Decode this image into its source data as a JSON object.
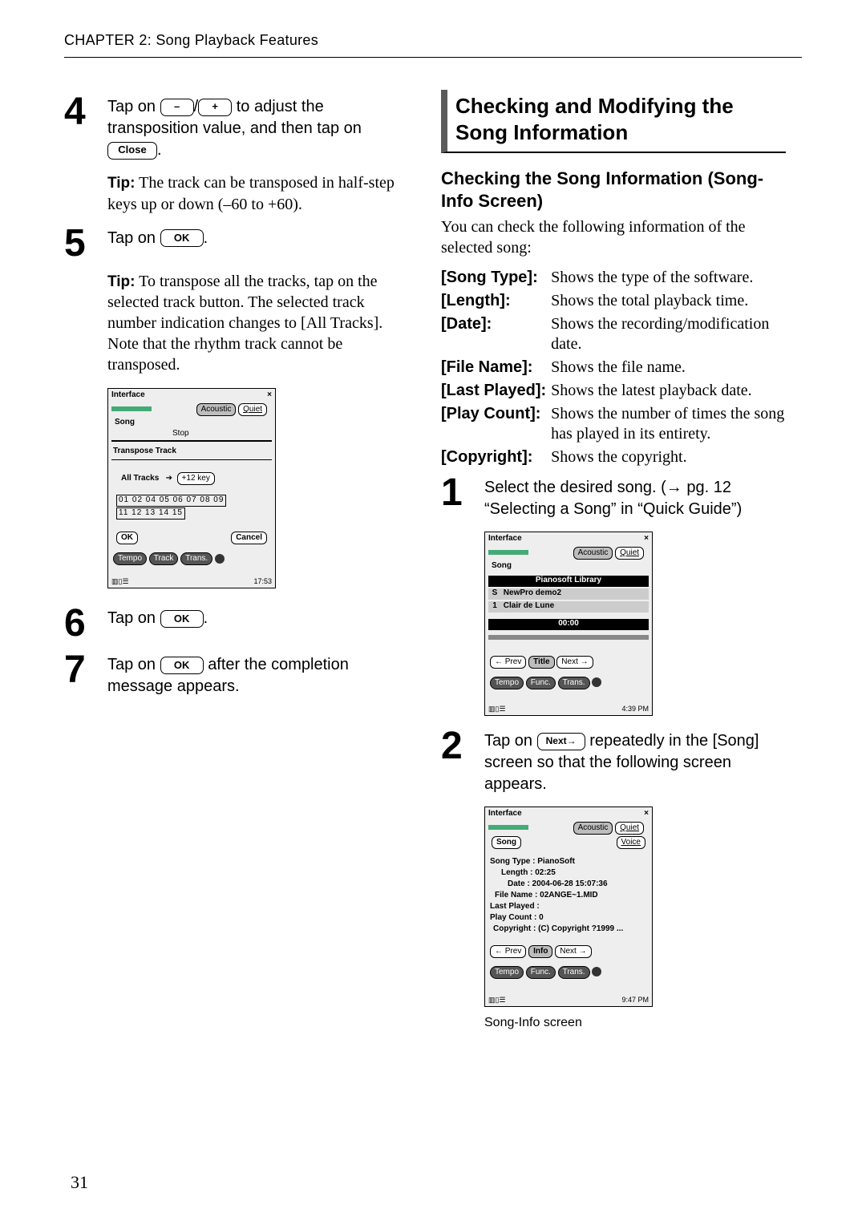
{
  "header": {
    "chapter": "CHAPTER 2: Song Playback Features"
  },
  "buttons": {
    "minus": "–",
    "plus": "+",
    "close": "Close",
    "ok": "OK",
    "next": "Next"
  },
  "left": {
    "step4": {
      "num": "4",
      "text_a": "Tap on",
      "text_b": "/",
      "text_c": "to adjust the transposition value, and then tap on",
      "text_d": "."
    },
    "tip4": {
      "label": "Tip:",
      "text": "The track can be transposed in half-step keys up or down (–60 to +60)."
    },
    "step5": {
      "num": "5",
      "text_a": "Tap on",
      "text_b": "."
    },
    "tip5": {
      "label": "Tip:",
      "text": "To transpose all the tracks, tap on the selected track button. The selected track number indication changes to [All Tracks]. Note that the rhythm track cannot be transposed."
    },
    "screenshot1": {
      "title": "Interface",
      "tab_acoustic": "Acoustic",
      "tab_quiet": "Quiet",
      "song": "Song",
      "stop": "Stop",
      "section": "Transpose Track",
      "all_tracks": "All Tracks",
      "keyval": "+12 key",
      "tracks_row1": "01 02    04 05 06 07 08 09",
      "tracks_row2": "11 12 13 14 15",
      "ok": "OK",
      "cancel": "Cancel",
      "tempo": "Tempo",
      "track": "Track",
      "trans": "Trans.",
      "time": "17:53"
    },
    "step6": {
      "num": "6",
      "text_a": "Tap on",
      "text_b": "."
    },
    "step7": {
      "num": "7",
      "text_a": "Tap on",
      "text_b": "after the completion message appears."
    }
  },
  "right": {
    "section_title": "Checking and Modifying the Song Information",
    "subheading": "Checking the Song Information (Song-Info Screen)",
    "intro": "You can check the following information of the selected song:",
    "info": [
      {
        "k": "[Song Type]:",
        "v": "Shows the type of the software."
      },
      {
        "k": "[Length]:",
        "v": "Shows the total playback time."
      },
      {
        "k": "[Date]:",
        "v": "Shows the recording/modification date."
      },
      {
        "k": "[File Name]:",
        "v": "Shows the file name."
      },
      {
        "k": "[Last Played]:",
        "v": "Shows the latest playback date."
      },
      {
        "k": "[Play Count]:",
        "v": "Shows the number of times the song has played in its entirety."
      },
      {
        "k": "[Copyright]:",
        "v": "Shows the copyright."
      }
    ],
    "step1": {
      "num": "1",
      "text": "Select the desired song. (→ pg. 12 “Selecting a Song” in “Quick Guide”)"
    },
    "screenshot2": {
      "title": "Interface",
      "tab_acoustic": "Acoustic",
      "tab_quiet": "Quiet",
      "song": "Song",
      "lib": "Pianosoft Library",
      "row_s": "S",
      "row_s_name": "NewPro demo2",
      "row_1": "1",
      "row_1_name": "Clair de Lune",
      "time_disp": "00:00",
      "prev": "Prev",
      "title_tab": "Title",
      "next": "Next",
      "tempo": "Tempo",
      "func": "Func.",
      "trans": "Trans.",
      "clock": "4:39 PM"
    },
    "step2": {
      "num": "2",
      "text_a": "Tap on",
      "text_b": "repeatedly in the [Song] screen so that the following screen appears."
    },
    "screenshot3": {
      "title": "Interface",
      "tab_acoustic": "Acoustic",
      "tab_quiet": "Quiet",
      "song": "Song",
      "voice": "Voice",
      "l1": "Song Type : PianoSoft",
      "l2": "Length : 02:25",
      "l3": "Date : 2004-06-28 15:07:36",
      "l4": "File Name : 02ANGE~1.MID",
      "l5": "Last Played :",
      "l6": "Play Count : 0",
      "l7": "Copyright : (C) Copyright ?1999 ...",
      "prev": "Prev",
      "info": "Info",
      "next": "Next",
      "tempo": "Tempo",
      "func": "Func.",
      "trans": "Trans.",
      "clock": "9:47 PM",
      "caption": "Song-Info screen"
    }
  },
  "page_number": "31"
}
